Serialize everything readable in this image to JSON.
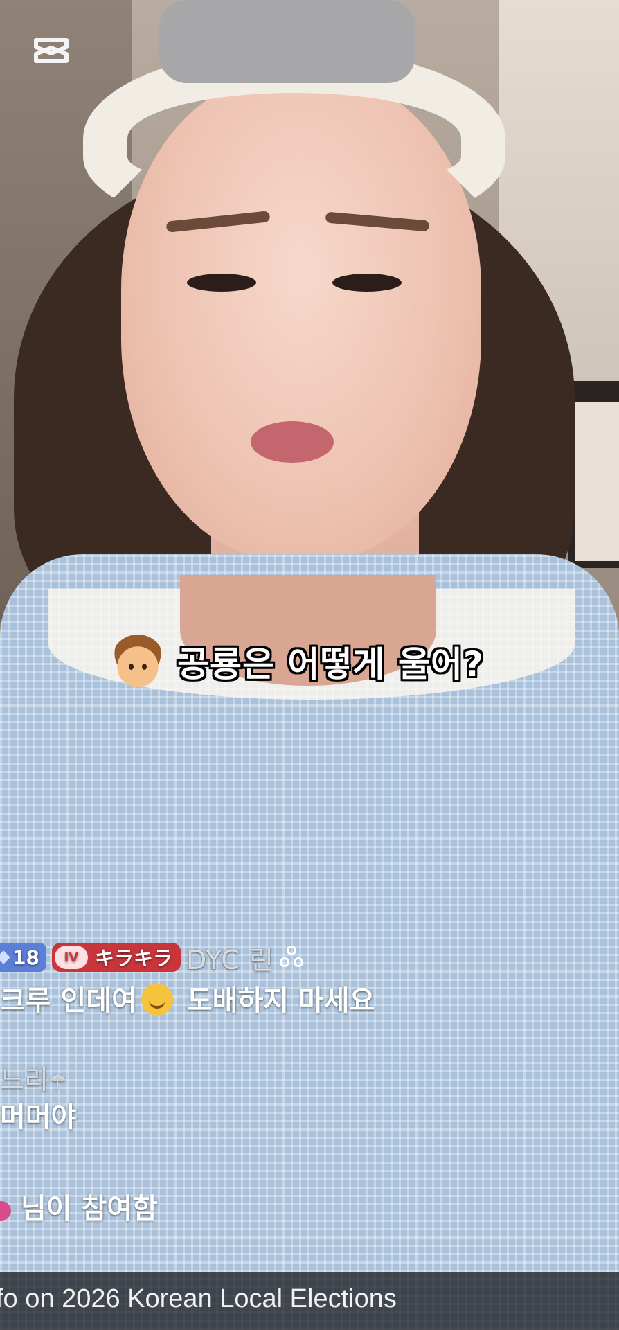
{
  "caption": {
    "avatar": "person-emoji-icon",
    "text": "공룡은 어떻게 울어?"
  },
  "live_chat": {
    "header": {
      "level": "18",
      "fan_badge_icon": "IV",
      "fan_badge_label": "キラキラ",
      "username": "DYC 린",
      "group_icon": "group-icon"
    },
    "messages": [
      {
        "text_before": "크루 인데여",
        "emoji": "smiling-face-icon",
        "text_after": " 도배하지 마세요"
      },
      {
        "user": "느리",
        "user_icon": "umbrella-icon",
        "text": "머머야"
      }
    ],
    "join_notice": "님이 참여함"
  },
  "banner": {
    "text": "fo on 2026 Korean Local Elections"
  },
  "watermark": "capcut-logo-icon",
  "colors": {
    "level_badge": "#5b7fd6",
    "fan_badge": "#c8353b",
    "banner_bg": "#141416"
  }
}
